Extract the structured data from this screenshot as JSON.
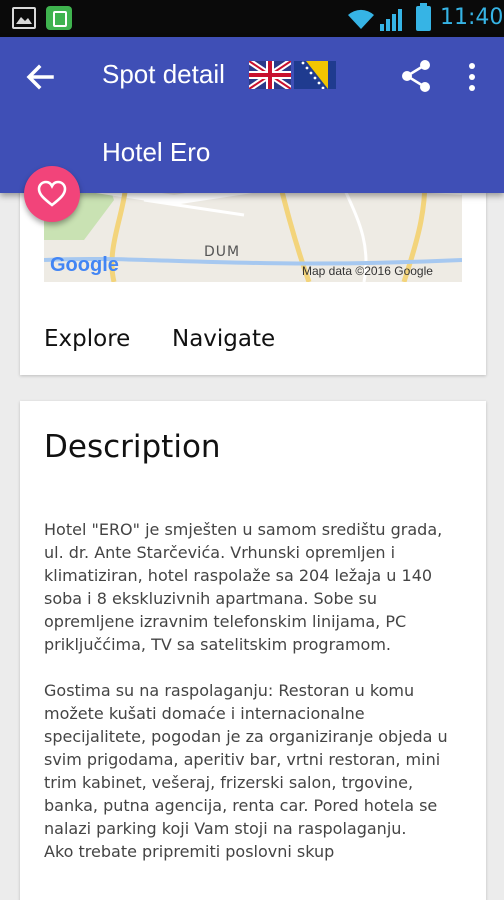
{
  "status_bar": {
    "time": "11:40",
    "icons": [
      "gallery-icon",
      "app-notification-icon",
      "wifi-icon",
      "signal-icon",
      "battery-icon"
    ],
    "accent_color": "#36b4e5"
  },
  "app_bar": {
    "title": "Spot detail",
    "subtitle": "Hotel Ero",
    "background_color": "#3f4fb6",
    "icons": [
      "back-arrow-icon",
      "uk-flag-icon",
      "bosnia-flag-icon",
      "share-icon",
      "more-vert-icon"
    ]
  },
  "fab": {
    "icon": "heart-icon",
    "color": "#f2447a"
  },
  "map": {
    "label_district": "DUM",
    "logo": "Google",
    "attribution": "Map data ©2016 Google"
  },
  "actions": {
    "explore_label": "Explore",
    "navigate_label": "Navigate"
  },
  "description": {
    "heading": "Description",
    "paragraphs": [
      "Hotel \"ERO\" je smješten u samom središtu grada, ul. dr. Ante Starčevića. Vrhunski opremljen i klimatiziran, hotel raspolaže sa 204 ležaja u 140 soba i 8 ekskluzivnih apartmana. Sobe su opremljene izravnim telefonskim linijama, PC priključćima, TV sa satelitskim programom.",
      "Gostima su na raspolaganju: Restoran u komu možete kušati domaće i internacionalne specijalitete, pogodan je za organiziranje objeda u svim prigodama, aperitiv bar, vrtni restoran, mini trim kabinet, vešeraj, frizerski salon, trgovine, banka, putna agencija, renta car. Pored hotela se nalazi parking koji Vam stoji na raspolaganju.\nAko trebate pripremiti poslovni skup"
    ]
  }
}
